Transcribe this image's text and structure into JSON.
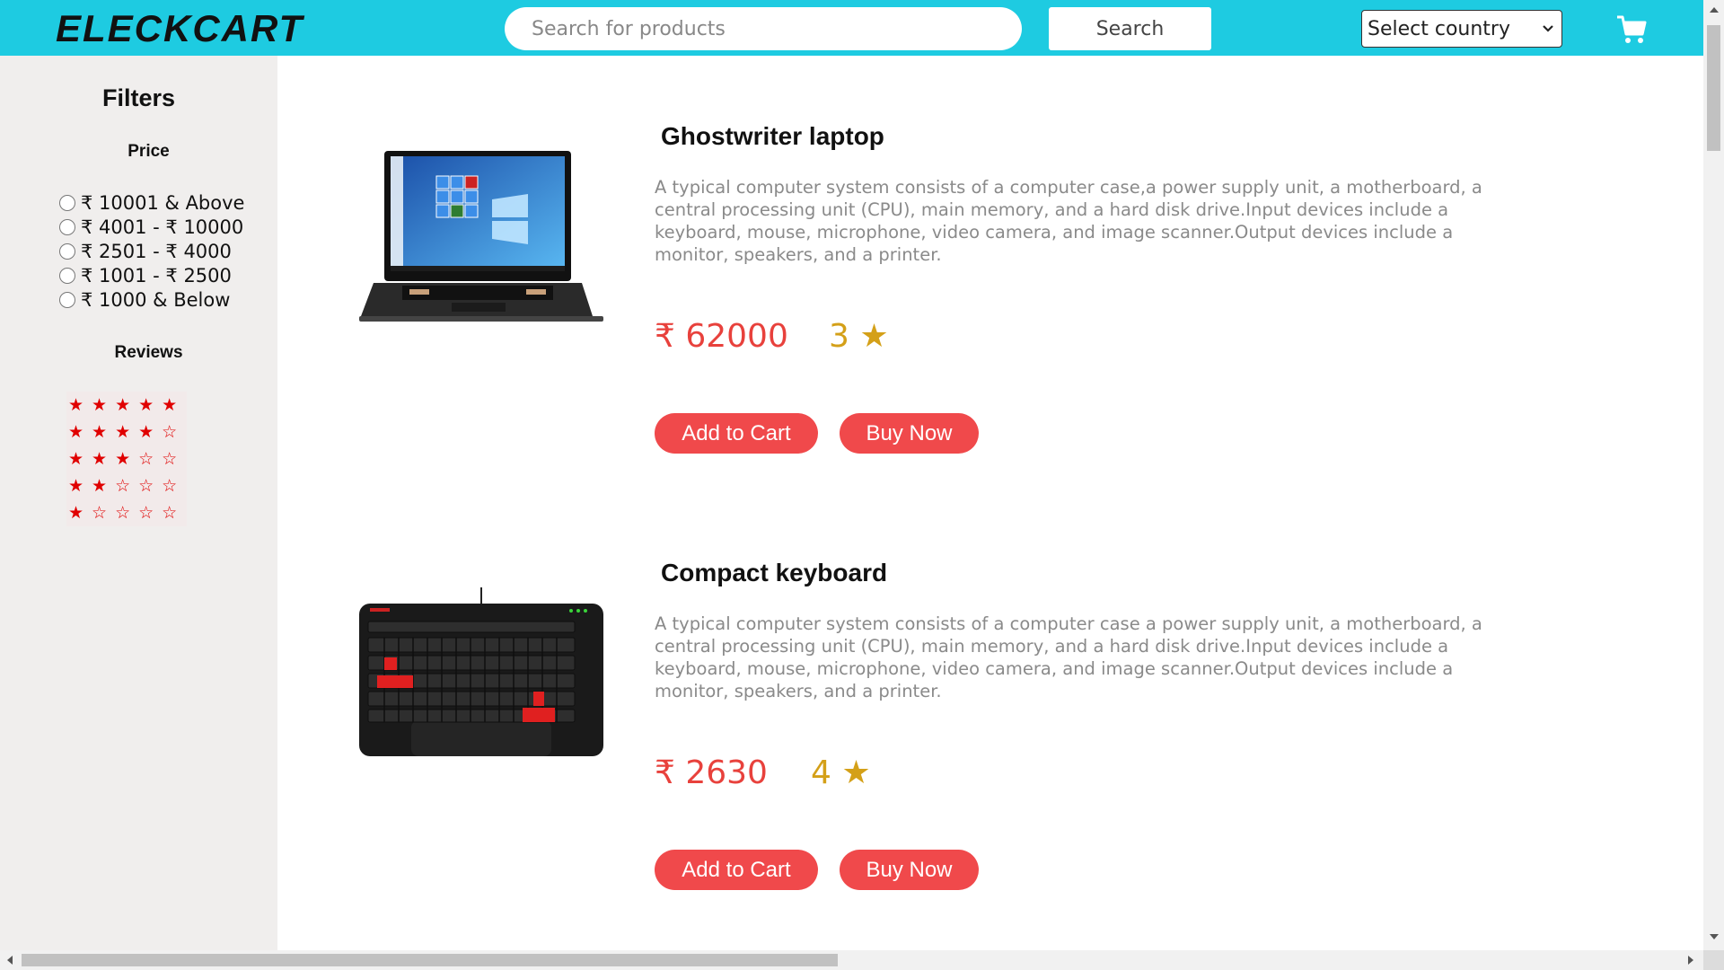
{
  "header": {
    "logo": "ELECKCART",
    "search_placeholder": "Search for products",
    "search_button": "Search",
    "country_select": "Select country",
    "cart_icon": "shopping-cart-icon"
  },
  "sidebar": {
    "title": "Filters",
    "price_title": "Price",
    "price_ranges": [
      "₹ 10001 & Above",
      "₹ 4001 - ₹ 10000",
      "₹ 2501 - ₹ 4000",
      "₹ 1001 - ₹ 2500",
      "₹ 1000 & Below"
    ],
    "reviews_title": "Reviews",
    "review_options": [
      "★★★★★",
      "★★★★☆",
      "★★★☆☆",
      "★★☆☆☆",
      "★☆☆☆☆"
    ]
  },
  "products": [
    {
      "name": "Ghostwriter laptop",
      "description": "A typical computer system consists of a computer case,a power supply unit, a motherboard, a central processing unit (CPU), main memory, and a hard disk drive.Input devices include a keyboard, mouse, microphone, video camera, and image scanner.Output devices include a monitor, speakers, and a printer.",
      "price": "₹ 62000",
      "rating": "3 ★",
      "add_to_cart": "Add to Cart",
      "buy_now": "Buy Now",
      "image": "laptop-image"
    },
    {
      "name": "Compact keyboard",
      "description": "A typical computer system consists of a computer case a power supply unit, a motherboard, a central processing unit (CPU), main memory, and a hard disk drive.Input devices include a keyboard, mouse, microphone, video camera, and image scanner.Output devices include a monitor, speakers, and a printer.",
      "price": "₹ 2630",
      "rating": "4 ★",
      "add_to_cart": "Add to Cart",
      "buy_now": "Buy Now",
      "image": "keyboard-image"
    }
  ],
  "colors": {
    "header_bg": "#1ecbe1",
    "sidebar_bg": "#f0eeed",
    "button_bg": "#f0494b",
    "price_color": "#e8413c",
    "rating_color": "#d4a018",
    "star_color": "#e00000"
  }
}
